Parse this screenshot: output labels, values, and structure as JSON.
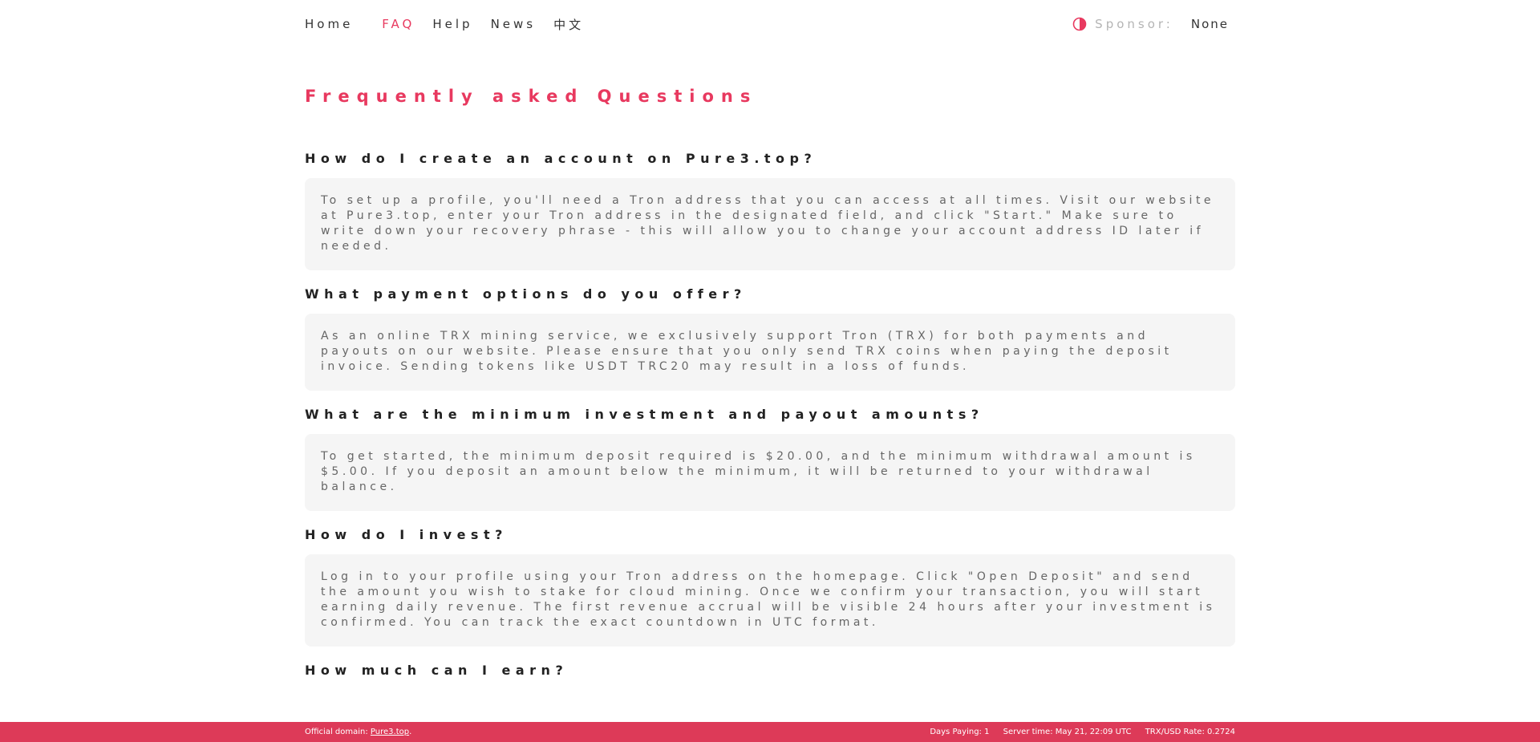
{
  "nav": {
    "home": "Home",
    "faq": "FAQ",
    "help": "Help",
    "news": "News",
    "lang": "中文"
  },
  "sponsor": {
    "icon": "contrast-icon",
    "label": "Sponsor:",
    "value": "None"
  },
  "colors": {
    "accent": "#e8395f",
    "footer_bg": "#dd3a58",
    "answer_bg": "#f5f5f5"
  },
  "page_title": "Frequently asked Questions",
  "faqs": [
    {
      "q": "How do I create an account on Pure3.top?",
      "a": "To set up a profile, you'll need a Tron address that you can access at all times. Visit our website at Pure3.top, enter your Tron address in the designated field, and click \"Start.\" Make sure to write down your recovery phrase - this will allow you to change your account address ID later if needed."
    },
    {
      "q": "What payment options do you offer?",
      "a": "As an online TRX mining service, we exclusively support Tron (TRX) for both payments and payouts on our website. Please ensure that you only send TRX coins when paying the deposit invoice. Sending tokens like USDT TRC20 may result in a loss of funds."
    },
    {
      "q": "What are the minimum investment and payout amounts?",
      "a": "To get started, the minimum deposit required is $20.00, and the minimum withdrawal amount is $5.00. If you deposit an amount below the minimum, it will be returned to your withdrawal balance."
    },
    {
      "q": "How do I invest?",
      "a": "Log in to your profile using your Tron address on the homepage. Click \"Open Deposit\" and send the amount you wish to stake for cloud mining. Once we confirm your transaction, you will start earning daily revenue. The first revenue accrual will be visible 24 hours after your investment is confirmed. You can track the exact countdown in UTC format."
    },
    {
      "q": "How much can I earn?",
      "a": ""
    }
  ],
  "footer": {
    "domain_label": "Official domain:",
    "domain_link": "Pure3.top",
    "domain_suffix": ".",
    "days_paying": "Days Paying: 1",
    "server_time": "Server time: May 21, 22:09 UTC",
    "rate": "TRX/USD Rate: 0.2724"
  }
}
